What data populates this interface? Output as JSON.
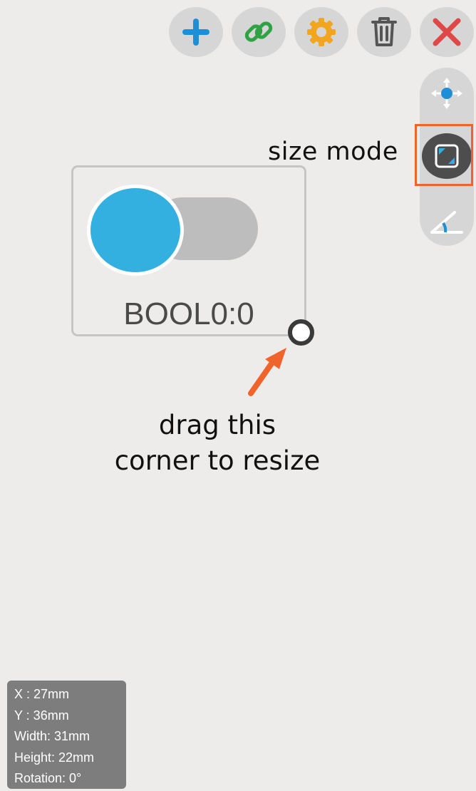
{
  "toolbar": {
    "buttons": [
      {
        "name": "add-button",
        "icon": "plus-icon",
        "color": "#1c8fd6"
      },
      {
        "name": "link-button",
        "icon": "link-icon",
        "color": "#2ea344"
      },
      {
        "name": "settings-button",
        "icon": "gear-icon",
        "color": "#f2a61f"
      },
      {
        "name": "delete-button",
        "icon": "trash-icon",
        "color": "#555555"
      },
      {
        "name": "close-button",
        "icon": "close-icon",
        "color": "#e04848"
      }
    ]
  },
  "modes": {
    "items": [
      {
        "name": "move-mode-button",
        "icon": "move-icon",
        "active": false
      },
      {
        "name": "size-mode-button",
        "icon": "resize-icon",
        "active": true
      },
      {
        "name": "rotate-mode-button",
        "icon": "angle-icon",
        "active": false
      }
    ],
    "size_mode_label": "size mode",
    "highlight_color": "#f0642c"
  },
  "widget": {
    "label": "BOOL0:0",
    "knob_color": "#34b0e0",
    "track_color": "#bdbdbd"
  },
  "hint": {
    "line1": "drag this",
    "line2": "corner to resize",
    "arrow_color": "#f0642c"
  },
  "info": {
    "x": "X  : 27mm",
    "y": "Y  : 36mm",
    "width": "Width: 31mm",
    "height": "Height: 22mm",
    "rotation": "Rotation: 0°"
  }
}
